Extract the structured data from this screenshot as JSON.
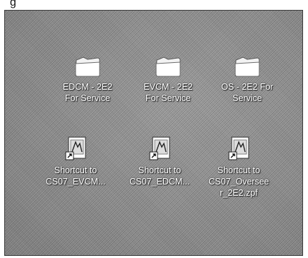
{
  "top_label": "g",
  "desktop": {
    "icons": [
      {
        "type": "folder",
        "line1": "EDCM - 2E2",
        "line2": "For Service"
      },
      {
        "type": "folder",
        "line1": "EVCM - 2E2",
        "line2": "For Service"
      },
      {
        "type": "folder",
        "line1": "OS - 2E2 For",
        "line2": "Service"
      },
      {
        "type": "shortcut",
        "line1": "Shortcut to",
        "line2": "CS07_EVCM..."
      },
      {
        "type": "shortcut",
        "line1": "Shortcut to",
        "line2": "CS07_EDCM..."
      },
      {
        "type": "shortcut",
        "line1": "Shortcut to",
        "line2": "CS07_Oversee",
        "line3": "r_2E2.zpf"
      }
    ]
  },
  "icon_names": {
    "folder": "folder-icon",
    "shortcut": "shortcut-file-icon"
  }
}
